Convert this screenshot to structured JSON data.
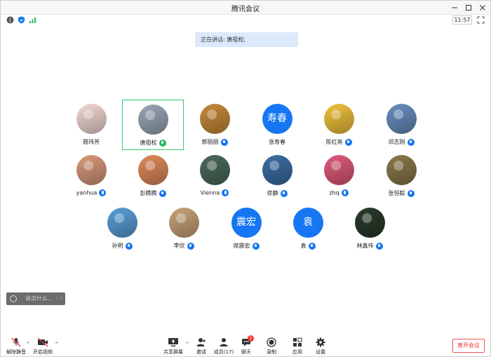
{
  "window": {
    "title": "腾讯会议"
  },
  "status": {
    "clock": "11:57"
  },
  "banner": {
    "text": "正在讲话: 唐祖权;"
  },
  "participants": [
    {
      "name": "聂玮芳",
      "avatar_color": "#f3d9d4",
      "mic": false,
      "active": false
    },
    {
      "name": "唐祖权",
      "avatar_color": "#9aa7b8",
      "mic": true,
      "mic_color": "green",
      "active": true
    },
    {
      "name": "郭丽丽",
      "avatar_color": "#c78b3a",
      "mic": true,
      "active": false
    },
    {
      "name": "张寿春",
      "avatar_text": "寿春",
      "mic": false,
      "active": false
    },
    {
      "name": "陈红亮",
      "avatar_color": "#f0c23c",
      "mic": true,
      "active": false
    },
    {
      "name": "邓志刚",
      "avatar_color": "#6a8fbf",
      "mic": true,
      "active": false
    },
    {
      "name": "yanhua",
      "avatar_color": "#d89a7a",
      "mic": true,
      "active": false
    },
    {
      "name": "彭腾腾",
      "avatar_color": "#e08a5a",
      "mic": true,
      "active": false
    },
    {
      "name": "Vienna",
      "avatar_color": "#4a6a5a",
      "mic": true,
      "active": false
    },
    {
      "name": "徐静",
      "avatar_color": "#3b6fa3",
      "mic": true,
      "active": false
    },
    {
      "name": "zhq",
      "avatar_color": "#e05a7a",
      "mic": true,
      "active": false
    },
    {
      "name": "张恒毅",
      "avatar_color": "#8a7a4a",
      "mic": true,
      "active": false
    },
    {
      "name": "孙明",
      "avatar_color": "#5aa0d8",
      "mic": true,
      "active": false
    },
    {
      "name": "李欣",
      "avatar_color": "#c9a37a",
      "mic": true,
      "active": false
    },
    {
      "name": "席震宏",
      "avatar_text": "震宏",
      "mic": true,
      "active": false
    },
    {
      "name": "袁",
      "avatar_text": "袁",
      "mic": true,
      "active": false
    },
    {
      "name": "林鑫伟",
      "avatar_color": "#2a3a2a",
      "mic": true,
      "active": false
    }
  ],
  "chat": {
    "placeholder": "说点什么..."
  },
  "toolbar": {
    "unmute": "解除静音",
    "start_video": "开启视频",
    "share": "共享屏幕",
    "invite": "邀请",
    "members": "成员(17)",
    "chat": "聊天",
    "chat_badge": "1",
    "record": "录制",
    "apps": "应用",
    "settings": "设置",
    "leave": "离开会议"
  },
  "colors": {
    "accent": "#1676f3",
    "active_border": "#2ecc71",
    "leave": "#e33333"
  }
}
